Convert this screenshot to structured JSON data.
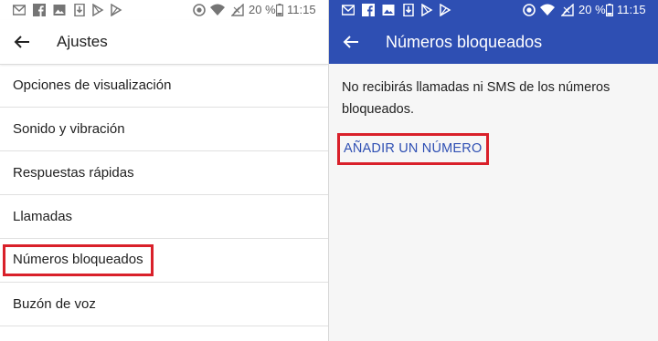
{
  "status_bar": {
    "battery_percent": "20 %",
    "time": "11:15"
  },
  "left_screen": {
    "title": "Ajustes",
    "items": [
      {
        "label": "Opciones de visualización"
      },
      {
        "label": "Sonido y vibración"
      },
      {
        "label": "Respuestas rápidas"
      },
      {
        "label": "Llamadas"
      },
      {
        "label": "Números bloqueados"
      },
      {
        "label": "Buzón de voz"
      }
    ]
  },
  "right_screen": {
    "title": "Números bloqueados",
    "message": "No recibirás llamadas ni SMS de los números bloqueados.",
    "add_button": "AÑADIR UN NÚMERO"
  },
  "colors": {
    "primary": "#2e4fb3",
    "highlight_box": "#d9202a",
    "background_right": "#f6f6f6"
  }
}
